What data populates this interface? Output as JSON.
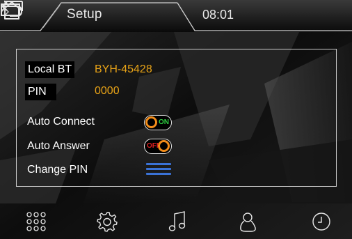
{
  "header": {
    "title": "Setup",
    "time": "08:01"
  },
  "settings": {
    "local_bt_label": "Local BT",
    "local_bt_value": "BYH-45428",
    "pin_label": "PIN",
    "pin_value": "0000",
    "auto_connect_label": "Auto Connect",
    "auto_connect_state": "ON",
    "auto_answer_label": "Auto Answer",
    "auto_answer_state": "OFF",
    "change_pin_label": "Change PIN"
  },
  "nav": {
    "items": [
      "apps-grid-icon",
      "settings-gear-icon",
      "music-note-icon",
      "contact-person-icon",
      "clock-icon"
    ]
  },
  "colors": {
    "accent_value": "#e8a317",
    "toggle_on": "#2ecc40",
    "toggle_off": "#e02020",
    "knob": "#f28c1a",
    "menu_blue": "#3a72d6"
  }
}
